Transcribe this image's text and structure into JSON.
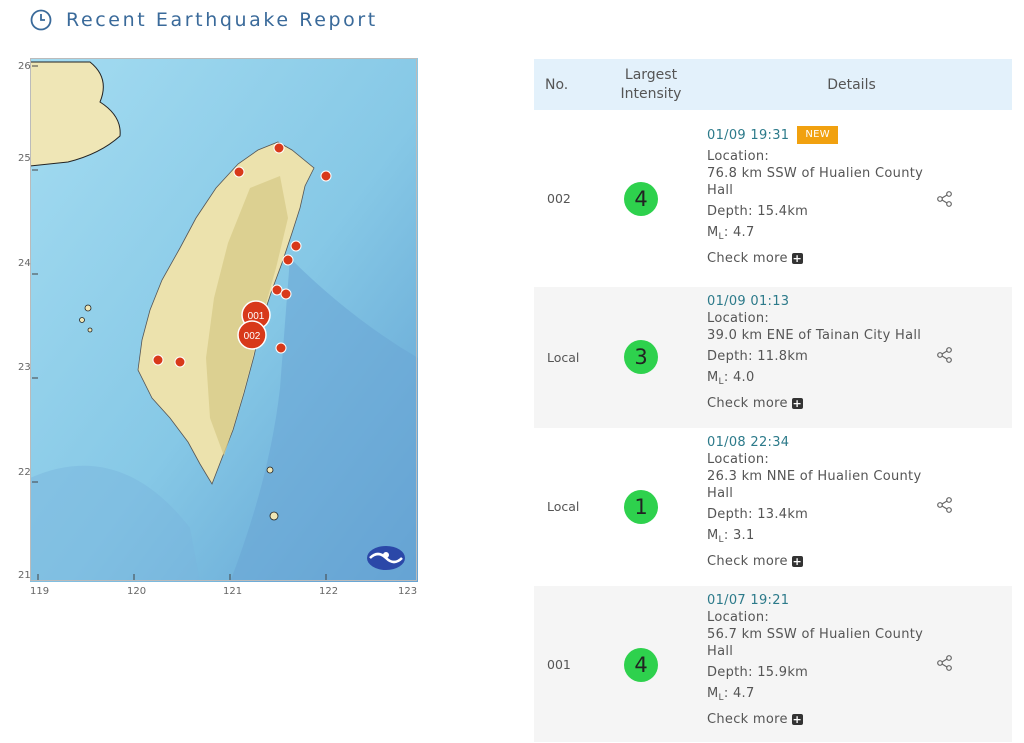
{
  "header": {
    "title": "Recent Earthquake Report"
  },
  "table": {
    "headers": {
      "no": "No.",
      "intensity_line1": "Largest",
      "intensity_line2": "Intensity",
      "details": "Details"
    },
    "rows": [
      {
        "no": "002",
        "intensity": "4",
        "datetime": "01/09 19:31",
        "badge": "NEW",
        "location_label": "Location:",
        "location": "76.8 km SSW of Hualien County Hall",
        "depth": "Depth: 15.4km",
        "ml_prefix": "M",
        "ml_sub": "L",
        "ml_value": ": 4.7",
        "more": "Check more"
      },
      {
        "no": "Local",
        "intensity": "3",
        "datetime": "01/09 01:13",
        "badge": "",
        "location_label": "Location:",
        "location": "39.0 km ENE of Tainan City Hall",
        "depth": "Depth: 11.8km",
        "ml_prefix": "M",
        "ml_sub": "L",
        "ml_value": ": 4.0",
        "more": "Check more"
      },
      {
        "no": "Local",
        "intensity": "1",
        "datetime": "01/08 22:34",
        "badge": "",
        "location_label": "Location:",
        "location": "26.3 km NNE of Hualien County Hall",
        "depth": "Depth: 13.4km",
        "ml_prefix": "M",
        "ml_sub": "L",
        "ml_value": ": 3.1",
        "more": "Check more"
      },
      {
        "no": "001",
        "intensity": "4",
        "datetime": "01/07 19:21",
        "badge": "",
        "location_label": "Location:",
        "location": "56.7 km SSW of Hualien County Hall",
        "depth": "Depth: 15.9km",
        "ml_prefix": "M",
        "ml_sub": "L",
        "ml_value": ": 4.7",
        "more": "Check more"
      }
    ]
  },
  "map": {
    "lat_labels": [
      "26",
      "25",
      "24",
      "23",
      "22",
      "21"
    ],
    "lon_labels": [
      "119",
      "120",
      "121",
      "122",
      "123"
    ],
    "markers": [
      "001",
      "002"
    ],
    "colors": {
      "sea": "#8ecfe8",
      "land": "#efe6b6",
      "quake": "#d8391a",
      "intensity": "#2ed14d",
      "new_badge": "#f1a10f",
      "header_bg": "#e3f1fb"
    }
  },
  "icons": {
    "header": "clock-icon",
    "share": "share-icon",
    "more": "plus-icon",
    "logo": "cwb-logo"
  }
}
